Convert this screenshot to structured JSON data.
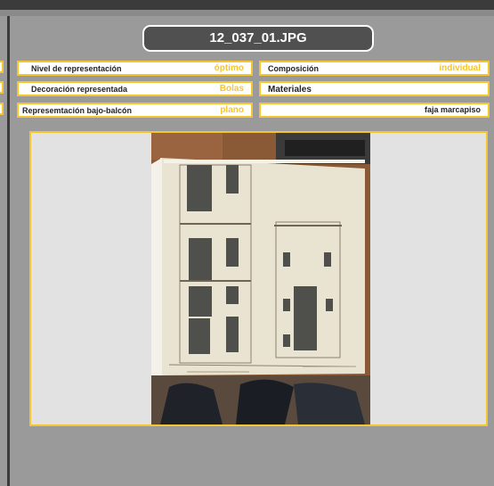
{
  "header": {
    "title": "12_037_01.JPG"
  },
  "fields": {
    "nivel": {
      "label": "Nivel de representación",
      "value": "óptimo"
    },
    "decoracion": {
      "label": "Decoración representada",
      "value": "Bolas"
    },
    "bajo_balcon": {
      "label": "Represemtación bajo-balcón",
      "value": "plano"
    },
    "composicion": {
      "label": "Composición",
      "value": "individual"
    },
    "materiales": {
      "label": "Materiales"
    },
    "materiales_valor": {
      "value": "faja marcapiso"
    }
  },
  "colors": {
    "accent": "#f5c531",
    "background": "#9a9a9a",
    "title_bg": "#505050",
    "panel": "#e2e2e2"
  },
  "photo": {
    "icon": "architectural-drawing-photo"
  }
}
